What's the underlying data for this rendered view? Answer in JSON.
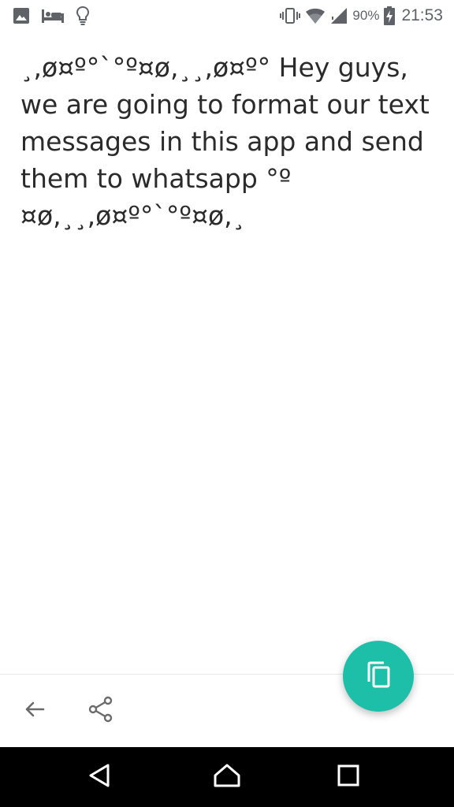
{
  "status_bar": {
    "left_icons": [
      "image-icon",
      "bed-icon",
      "lightbulb-icon"
    ],
    "right_icons": [
      "vibrate-icon",
      "wifi-icon",
      "cell-signal-icon",
      "battery-charging-icon"
    ],
    "battery_percent": "90%",
    "time": "21:53"
  },
  "main": {
    "message": "¸,ø¤º°`°º¤ø,¸¸,ø¤º° Hey guys, we are going to format our text messages in this app and send them to whatsapp °º ¤ø,¸¸,ø¤º°`°º¤ø,¸"
  },
  "toolbar": {
    "back_icon": "arrow-left-icon",
    "share_icon": "share-icon"
  },
  "fab": {
    "icon": "copy-icon",
    "color": "#1dbfa8"
  },
  "nav_bar": {
    "icons": [
      "back-triangle-icon",
      "home-icon",
      "recents-icon"
    ]
  },
  "colors": {
    "text": "#2b2b2b",
    "status": "#5f6368",
    "accent": "#1dbfa8",
    "nav_bg": "#000000"
  }
}
